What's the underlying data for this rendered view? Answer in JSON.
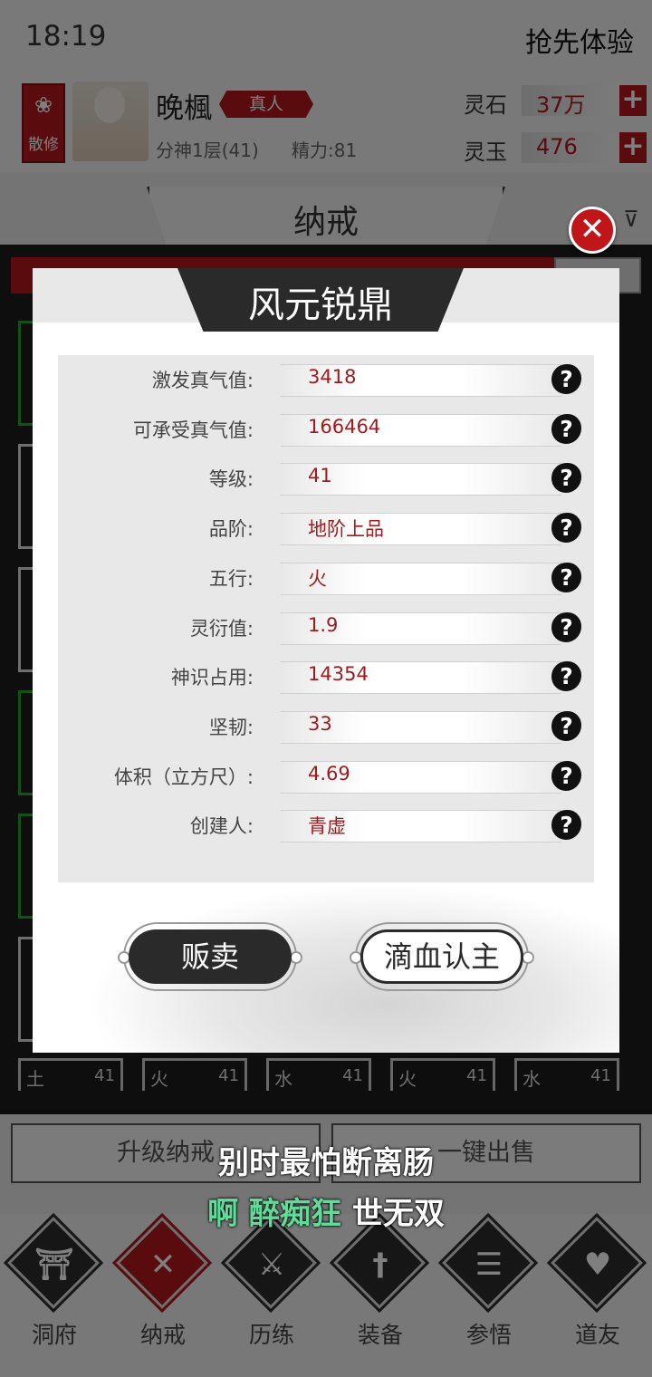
{
  "status_bar": {
    "time": "18:19",
    "trial_label": "抢先体验"
  },
  "profile": {
    "sect_label": "散修",
    "name": "晚楓",
    "rank": "真人",
    "realm": "分神1层(41)",
    "energy": "精力:81",
    "resources": [
      {
        "label": "灵石",
        "value": "37万"
      },
      {
        "label": "灵玉",
        "value": "476"
      }
    ]
  },
  "panel": {
    "title": "纳戒"
  },
  "modal": {
    "title": "风元锐鼎",
    "properties": [
      {
        "label": "激发真气值:",
        "value": "3418"
      },
      {
        "label": "可承受真气值:",
        "value": "166464"
      },
      {
        "label": "等级:",
        "value": "41"
      },
      {
        "label": "品阶:",
        "value": "地阶上品"
      },
      {
        "label": "五行:",
        "value": "火"
      },
      {
        "label": "灵衍值:",
        "value": "1.9"
      },
      {
        "label": "神识占用:",
        "value": "14354"
      },
      {
        "label": "坚韧:",
        "value": "33"
      },
      {
        "label": "体积（立方尺）:",
        "value": "4.69"
      },
      {
        "label": "创建人:",
        "value": "青虚"
      }
    ],
    "sell_label": "贩卖",
    "bind_label": "滴血认主",
    "help_glyph": "?",
    "close_glyph": "✕"
  },
  "bottom_slots": [
    {
      "element": "土",
      "level": "41"
    },
    {
      "element": "火",
      "level": "41"
    },
    {
      "element": "水",
      "level": "41"
    },
    {
      "element": "火",
      "level": "41"
    },
    {
      "element": "水",
      "level": "41"
    }
  ],
  "actions": {
    "upgrade_label": "升级纳戒",
    "sell_all_label": "一键出售"
  },
  "nav": [
    {
      "label": "洞府",
      "icon": "pavilion-icon"
    },
    {
      "label": "纳戒",
      "icon": "ring-icon"
    },
    {
      "label": "历练",
      "icon": "crossed-swords-icon"
    },
    {
      "label": "装备",
      "icon": "sword-icon"
    },
    {
      "label": "参悟",
      "icon": "book-icon"
    },
    {
      "label": "道友",
      "icon": "handshake-icon"
    }
  ],
  "lyrics": {
    "line1": "别时最怕断离肠",
    "line2_highlight": "啊 醉痴狂",
    "line2_rest": " 世无双"
  },
  "colors": {
    "accent_red": "#b3171b",
    "value_red": "#a01b1e",
    "lyric_green": "#5fdc9a"
  }
}
